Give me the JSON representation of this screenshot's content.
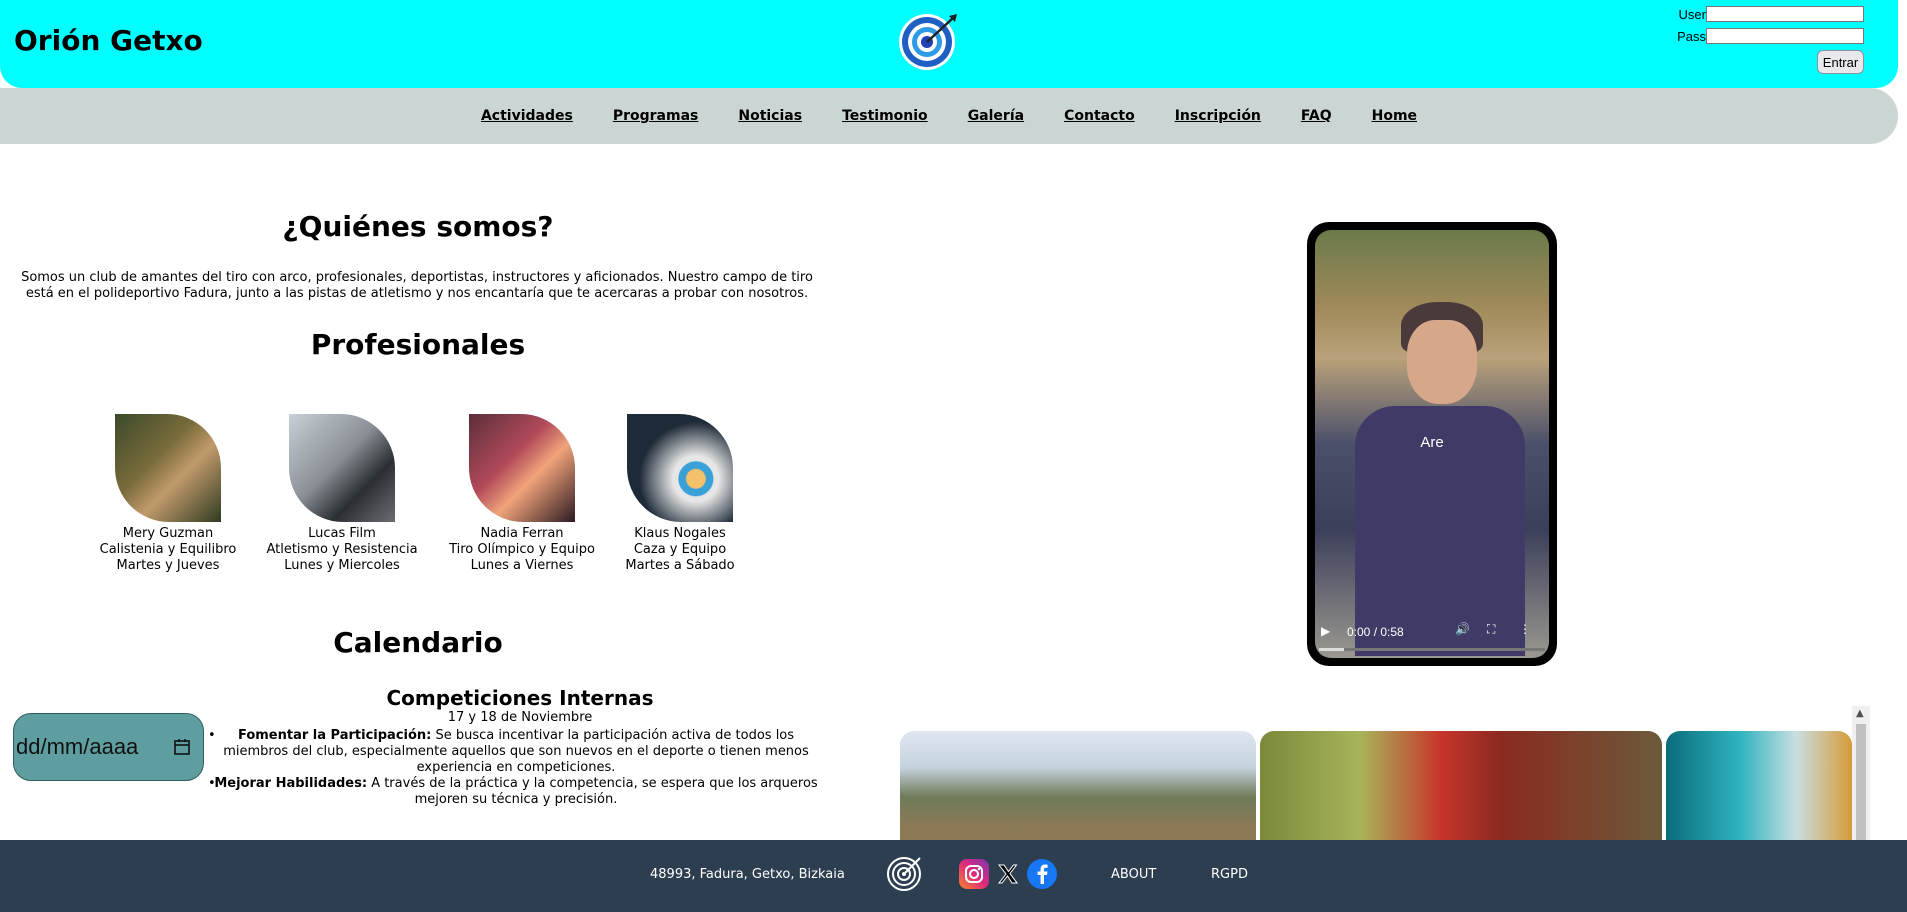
{
  "header": {
    "brand": "Orión Getxo",
    "login": {
      "user_label": "User",
      "pass_label": "Pass",
      "submit_label": "Entrar"
    }
  },
  "nav": {
    "items": [
      "Actividades",
      "Programas",
      "Noticias",
      "Testimonio",
      "Galería",
      "Contacto",
      "Inscripción",
      "FAQ",
      "Home"
    ]
  },
  "about": {
    "title": "¿Quiénes somos?",
    "text": "Somos un club de amantes del tiro con arco, profesionales, deportistas, instructores y aficionados. Nuestro campo de tiro está en el polideportivo Fadura, junto a las pistas de atletismo y nos encantaría que te acercaras a probar con nosotros."
  },
  "professionals": {
    "title": "Profesionales",
    "people": [
      {
        "name": "Mery Guzman",
        "discipline": "Calistenia y Equilibro",
        "schedule": "Martes y Jueves"
      },
      {
        "name": "Lucas Film",
        "discipline": "Atletismo y Resistencia",
        "schedule": "Lunes y Miercoles"
      },
      {
        "name": "Nadia Ferran",
        "discipline": "Tiro Olímpico y Equipo",
        "schedule": "Lunes a Viernes"
      },
      {
        "name": "Klaus Nogales",
        "discipline": "Caza y Equipo",
        "schedule": "Martes a Sábado"
      }
    ]
  },
  "calendar": {
    "title": "Calendario",
    "date_placeholder": "dd/mm/aaaa",
    "competition": {
      "title": "Competiciones Internas",
      "date": "17 y 18 de Noviembre",
      "items": [
        {
          "label": "Fomentar la Participación:",
          "text": "Se busca incentivar la participación activa de todos los miembros del club, especialmente aquellos que son nuevos en el deporte o tienen menos experiencia en competiciones."
        },
        {
          "label": "Mejorar Habilidades:",
          "text": "A través de la práctica y la competencia, se espera que los arqueros mejoren su técnica y precisión."
        }
      ]
    }
  },
  "video": {
    "caption": "Are",
    "time": "0:00 / 0:58",
    "progress": 0.11
  },
  "footer": {
    "address": "48993, Fadura, Getxo, Bizkaia",
    "links": [
      "ABOUT",
      "RGPD"
    ]
  },
  "icons": {
    "logo": "target-arrow-icon",
    "instagram": "instagram-icon",
    "x": "x-icon",
    "facebook": "facebook-icon"
  }
}
